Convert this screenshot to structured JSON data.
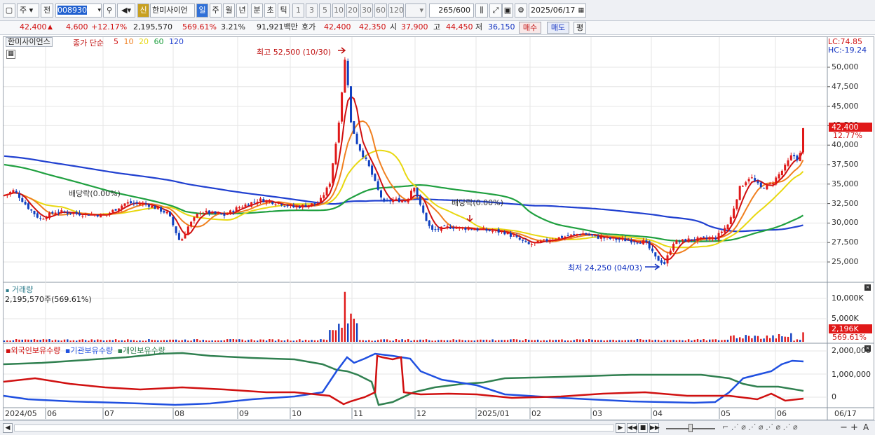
{
  "toolbar": {
    "market": "주",
    "period_mode": "전",
    "code": "008930",
    "badge": "신",
    "stock_name": "한미사이언",
    "intervals": [
      "일",
      "주",
      "월",
      "년",
      "분",
      "초",
      "틱"
    ],
    "ticks": [
      "1",
      "3",
      "5",
      "10",
      "20",
      "30",
      "60",
      "120"
    ],
    "count": "265",
    "count_max": "/600",
    "date": "2025/06/17"
  },
  "info": {
    "price": "42,400",
    "change": "4,600",
    "change_pct": "+12.17%",
    "volume": "2,195,570",
    "volume_pct": "569.61%",
    "turnover_pct": "3.21%",
    "amount": "91,921백만",
    "bid_label": "호가",
    "ask": "42,400",
    "bid": "42,350",
    "open_label": "시",
    "open": "37,900",
    "high_label": "고",
    "high": "44,450",
    "low_label": "저",
    "low": "36,150",
    "buy_btn": "매수",
    "sell_btn": "매도",
    "eval_btn": "평"
  },
  "chart": {
    "stock_label": "한미사이언스",
    "ma_label": "종가 단순",
    "ma_periods": [
      {
        "p": "5",
        "color": "#d01010"
      },
      {
        "p": "10",
        "color": "#f08020"
      },
      {
        "p": "20",
        "color": "#e8d810"
      },
      {
        "p": "60",
        "color": "#20a040"
      },
      {
        "p": "120",
        "color": "#2040d0"
      }
    ],
    "lc": "LC:74.85",
    "hc": "HC:-19.24",
    "high_annot": "최고 52,500 (10/30)",
    "low_annot": "최저 24,250 (04/03)",
    "dividend1": "배당락(0.00%)",
    "dividend2": "배당락(0.00%)",
    "price_tag": "42,400",
    "price_tag_pct": "12.77%",
    "yticks": [
      "50,000",
      "47,500",
      "45,000",
      "42,500",
      "40,000",
      "37,500",
      "35,000",
      "32,500",
      "30,000",
      "27,500",
      "25,000"
    ],
    "volume_label": "거래량",
    "volume_value": "2,195,570주(569.61%)",
    "vol_yticks": [
      "10,000K",
      "5,000K"
    ],
    "vol_tag": "2,196K",
    "vol_tag_pct": "569.61%",
    "holding_legend": [
      "외국인보유수량",
      "기관보유수량",
      "개인보유수량"
    ],
    "holding_colors": [
      "#d01010",
      "#2050e0",
      "#308050"
    ],
    "hold_yticks": [
      "2,000,000",
      "1,000,000",
      "0"
    ],
    "xticks": [
      "2024/05",
      "06",
      "07",
      "08",
      "09",
      "10",
      "11",
      "12",
      "2025/01",
      "02",
      "03",
      "04",
      "05",
      "06",
      "06/17"
    ],
    "colors": {
      "up": "#e01818",
      "down": "#1040c0"
    }
  }
}
